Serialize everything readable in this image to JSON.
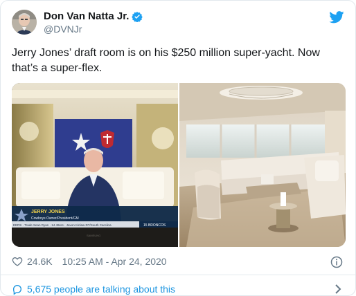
{
  "user": {
    "name": "Don Van Natta Jr.",
    "handle": "@DVNJr"
  },
  "tweet": {
    "text": "Jerry Jones’ draft room is on his $250 million super-yacht. Now that’s a super-flex."
  },
  "media": {
    "left": {
      "lower_third_name": "JERRY JONES",
      "lower_third_title": "Cowboys Owner/President/GM",
      "ticker": "EERS · Trade Sean Ryan · 14 49ers · Javon Kinlaw DT/South Carolina",
      "ticker_team": "15 BRONCOS",
      "tv_brand": "SAMSUNG"
    }
  },
  "meta": {
    "likes": "24.6K",
    "timestamp": "10:25 AM - Apr 24, 2020"
  },
  "footer": {
    "talking": "5,675 people are talking about this"
  },
  "colors": {
    "accent": "#1da1f2",
    "link": "#1b95e0",
    "muted": "#657786"
  },
  "icons": [
    "verified-badge-icon",
    "twitter-bird-icon",
    "heart-icon",
    "info-icon",
    "comment-bubble-icon",
    "chevron-right-icon"
  ]
}
